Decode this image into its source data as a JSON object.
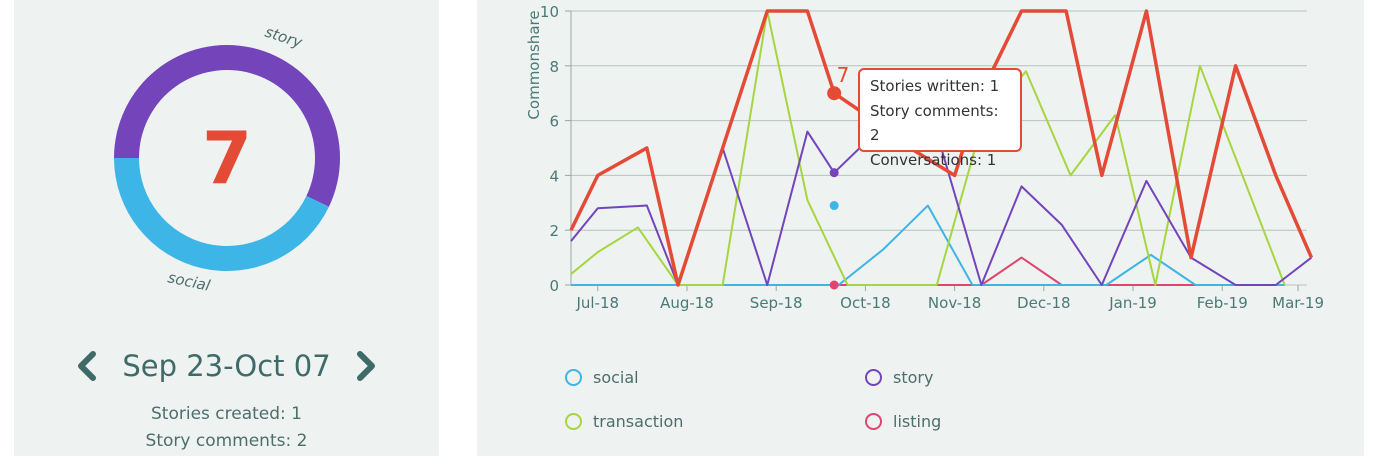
{
  "colors": {
    "story": "#7444bb",
    "social": "#3db5e6",
    "transaction": "#a5d63f",
    "listing": "#e0446f",
    "total": "#e34b36",
    "axis_text": "#4a7a76"
  },
  "summary": {
    "total": "7",
    "donut_labels": {
      "story": "story",
      "social": "social"
    },
    "donut_fractions": {
      "story": 0.571,
      "social": 0.429
    },
    "period": "Sep 23-Oct 07",
    "prev_icon": "chevron-left-icon",
    "next_icon": "chevron-right-icon",
    "stats": [
      "Stories created: 1",
      "Story comments: 2"
    ]
  },
  "tooltip": {
    "lines": [
      "Stories written: 1",
      "Story comments: 2",
      "Conversations: 1"
    ],
    "value_label": "7"
  },
  "chart_data": {
    "type": "line",
    "ylabel": "Commonshare",
    "ylim": [
      0,
      10
    ],
    "yticks": [
      0,
      2,
      4,
      6,
      8,
      10
    ],
    "xlim": [
      0,
      16.5
    ],
    "x_tick_labels": [
      "Jul-18",
      "Aug-18",
      "Sep-18",
      "Oct-18",
      "Nov-18",
      "Dec-18",
      "Jan-19",
      "Feb-19",
      "Mar-19"
    ],
    "x_tick_positions": [
      0.6,
      2.6,
      4.6,
      6.6,
      8.6,
      10.6,
      12.6,
      14.6,
      16.3
    ],
    "grid": true,
    "legend_position": "bottom",
    "series": [
      {
        "name": "social",
        "key": "social",
        "x": [
          0,
          1,
          2,
          3,
          4,
          5,
          6,
          7,
          8,
          9,
          10,
          11,
          12,
          13,
          14,
          15,
          16
        ],
        "values": [
          0,
          0,
          0,
          0,
          0,
          0,
          0,
          1.3,
          2.9,
          0,
          0,
          0,
          0,
          1.1,
          0,
          0,
          0
        ]
      },
      {
        "name": "story",
        "key": "story",
        "x": [
          0,
          0.6,
          1.7,
          2.4,
          3.4,
          4.4,
          5.3,
          5.9,
          6.6,
          7.5,
          8.3,
          9.2,
          10.1,
          11,
          11.9,
          12.9,
          13.9,
          14.9,
          15.8,
          16.6
        ],
        "values": [
          1.6,
          2.8,
          2.9,
          0,
          5,
          0,
          5.6,
          4.1,
          5.2,
          5.1,
          5.0,
          0,
          3.6,
          2.2,
          0,
          3.8,
          1,
          0,
          0,
          1
        ]
      },
      {
        "name": "transaction",
        "key": "transaction",
        "x": [
          0,
          0.6,
          1.5,
          2.4,
          3.4,
          4.4,
          5.3,
          6.2,
          7.2,
          8.2,
          9.2,
          10.2,
          11.2,
          12.2,
          13.1,
          14.1,
          15.1,
          16
        ],
        "values": [
          0.4,
          1.2,
          2.1,
          0,
          0,
          10,
          3.1,
          0,
          0,
          0,
          5.8,
          7.8,
          4.0,
          6.2,
          0,
          8,
          3.8,
          0
        ]
      },
      {
        "name": "listing",
        "key": "listing",
        "x": [
          0,
          1,
          2,
          3,
          4,
          5,
          5.8,
          6.7,
          7.5,
          8.4,
          9.2,
          10.1,
          11,
          12,
          13,
          14,
          15,
          16
        ],
        "values": [
          0,
          0,
          0,
          0,
          0,
          0,
          0,
          0,
          0,
          0,
          0,
          1,
          0,
          0,
          0,
          0,
          0,
          0
        ]
      },
      {
        "key": "total",
        "x": [
          0,
          0.6,
          1.7,
          2.4,
          3.4,
          4.4,
          5.3,
          5.9,
          6.8,
          7.6,
          8.6,
          9.2,
          10.1,
          11.1,
          11.9,
          12.9,
          13.9,
          14.9,
          15.8,
          16.6
        ],
        "values": [
          2,
          4,
          5,
          0,
          5,
          10,
          10,
          7,
          6,
          5,
          4,
          7,
          10,
          10,
          4,
          10,
          1,
          8,
          4,
          1
        ]
      }
    ],
    "highlight": {
      "x": 5.9,
      "points": [
        {
          "series": "total",
          "value": 7
        },
        {
          "series": "story",
          "value": 4.1
        },
        {
          "series": "social",
          "value": 2.9
        },
        {
          "series": "listing",
          "value": 0
        }
      ]
    }
  },
  "legend": [
    {
      "key": "social",
      "label": "social"
    },
    {
      "key": "story",
      "label": "story"
    },
    {
      "key": "transaction",
      "label": "transaction"
    },
    {
      "key": "listing",
      "label": "listing"
    }
  ]
}
